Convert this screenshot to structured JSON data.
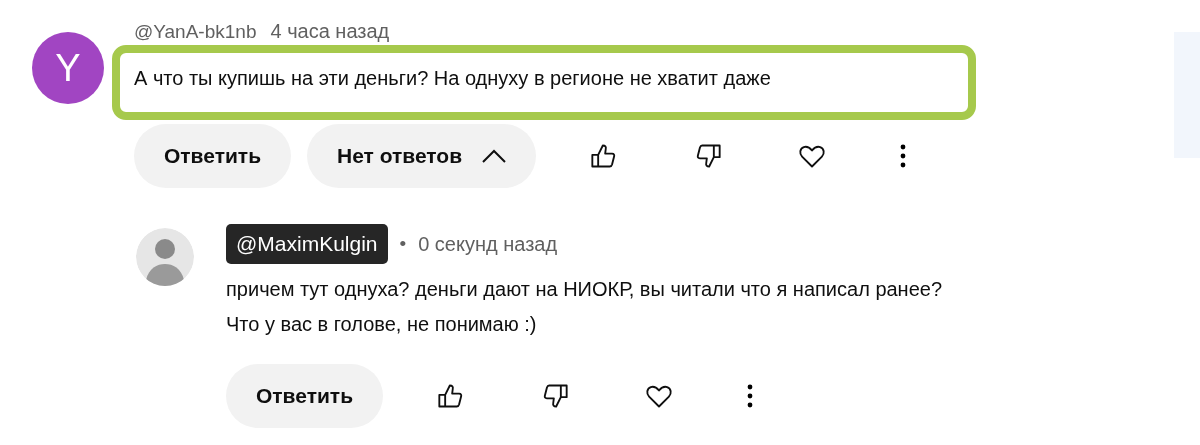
{
  "comments": [
    {
      "avatar": {
        "kind": "letter",
        "letter": "Y"
      },
      "author": "@YanA-bk1nb",
      "author_badge": false,
      "time": "4 часа назад",
      "lines": [
        "А что ты купишь на эти деньги? На однуху в регионе не хватит даже"
      ],
      "highlighted": true,
      "reply_button": "Ответить",
      "replies_toggle": "Нет ответов",
      "indent": false
    },
    {
      "author": "@MaximKulgin",
      "author_badge": true,
      "separator": "•",
      "time": "0 секунд назад",
      "lines": [
        "причем тут однуха? деньги дают на НИОКР, вы читали что я написал ранее?",
        "Что у вас в голове, не понимаю :)"
      ],
      "highlighted": false,
      "reply_button": "Ответить",
      "indent": true
    }
  ]
}
